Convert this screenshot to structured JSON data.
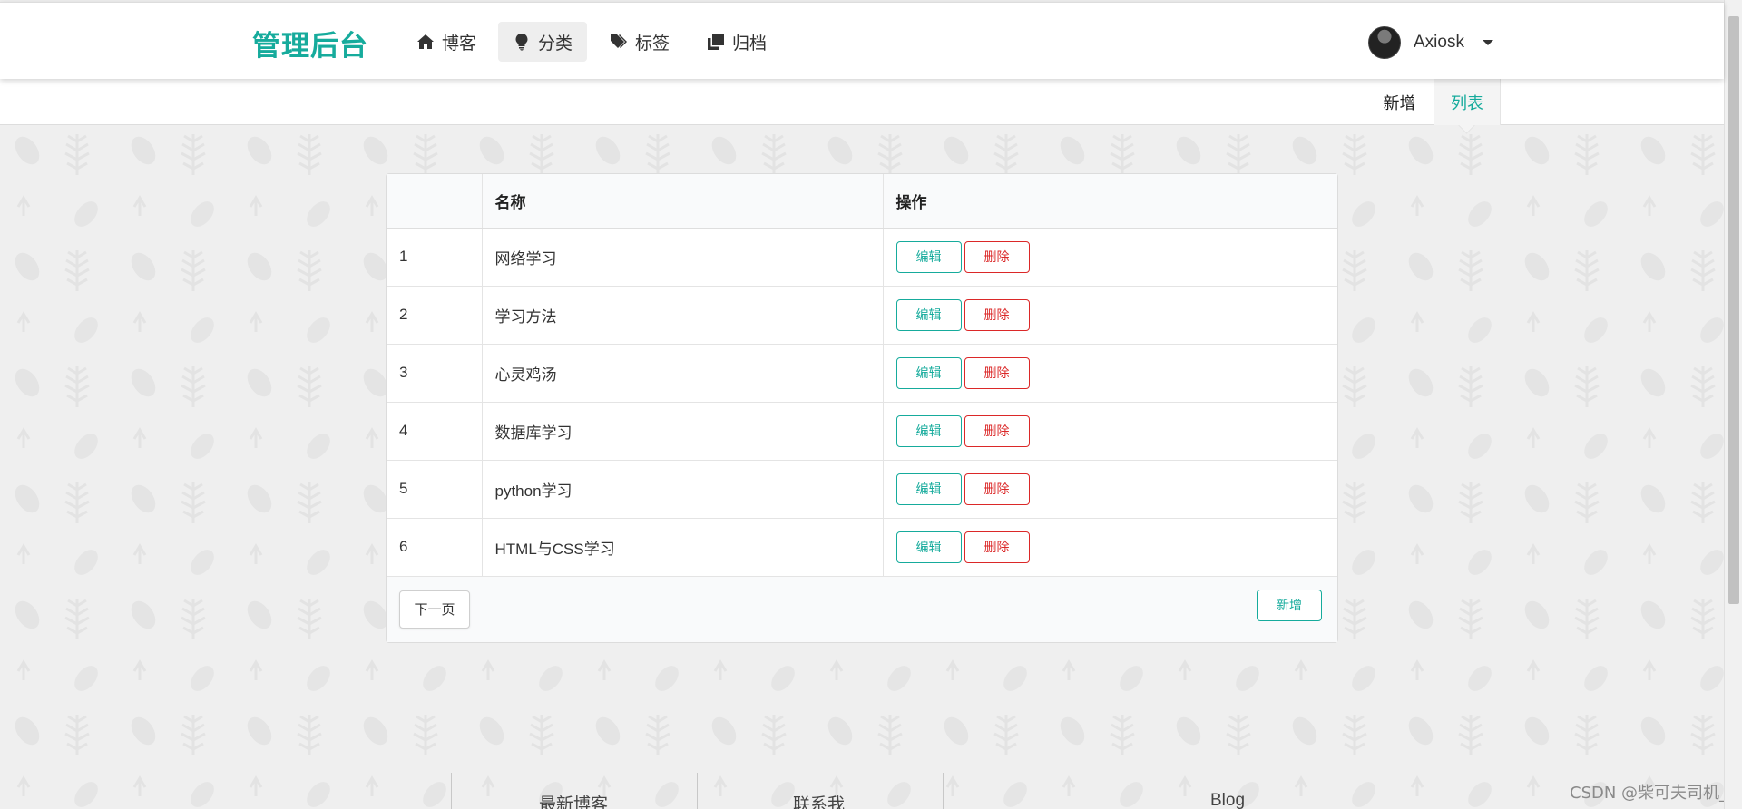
{
  "nav": {
    "brand": "管理后台",
    "items": [
      {
        "label": "博客",
        "icon": "home-icon",
        "active": false
      },
      {
        "label": "分类",
        "icon": "lightbulb-icon",
        "active": true
      },
      {
        "label": "标签",
        "icon": "tags-icon",
        "active": false
      },
      {
        "label": "归档",
        "icon": "clone-icon",
        "active": false
      }
    ],
    "user": {
      "name": "Axiosk"
    }
  },
  "submenu": {
    "items": [
      {
        "label": "新增",
        "active": false
      },
      {
        "label": "列表",
        "active": true
      }
    ]
  },
  "table": {
    "headers": [
      "",
      "名称",
      "操作"
    ],
    "rows": [
      {
        "index": "1",
        "name": "网络学习",
        "edit": "编辑",
        "delete": "删除"
      },
      {
        "index": "2",
        "name": "学习方法",
        "edit": "编辑",
        "delete": "删除"
      },
      {
        "index": "3",
        "name": "心灵鸡汤",
        "edit": "编辑",
        "delete": "删除"
      },
      {
        "index": "4",
        "name": "数据库学习",
        "edit": "编辑",
        "delete": "删除"
      },
      {
        "index": "5",
        "name": "python学习",
        "edit": "编辑",
        "delete": "删除"
      },
      {
        "index": "6",
        "name": "HTML与CSS学习",
        "edit": "编辑",
        "delete": "删除"
      }
    ],
    "next_label": "下一页",
    "add_label": "新增"
  },
  "footer": {
    "columns": [
      "最新博客",
      "联系我",
      "Blog"
    ]
  },
  "watermark": "CSDN @柴可夫司机_",
  "colors": {
    "accent": "#16ab9c",
    "danger": "#db2828"
  }
}
